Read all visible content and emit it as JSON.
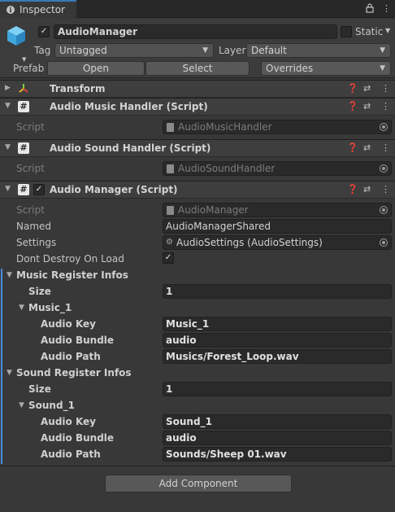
{
  "window": {
    "tab_title": "Inspector"
  },
  "header": {
    "object_name": "AudioManager",
    "active": true,
    "static_label": "Static",
    "tag_label": "Tag",
    "tag_value": "Untagged",
    "layer_label": "Layer",
    "layer_value": "Default",
    "prefab_label": "Prefab",
    "open_label": "Open",
    "select_label": "Select",
    "overrides_label": "Overrides"
  },
  "components": {
    "transform": {
      "title": "Transform"
    },
    "music_handler": {
      "title": "Audio Music Handler (Script)",
      "script_label": "Script",
      "script_value": "AudioMusicHandler"
    },
    "sound_handler": {
      "title": "Audio Sound Handler (Script)",
      "script_label": "Script",
      "script_value": "AudioSoundHandler"
    },
    "audio_manager": {
      "title": "Audio Manager (Script)",
      "enabled": true,
      "script_label": "Script",
      "script_value": "AudioManager",
      "named_label": "Named",
      "named_value": "AudioManagerShared",
      "settings_label": "Settings",
      "settings_value": "AudioSettings (AudioSettings)",
      "dont_destroy_label": "Dont Destroy On Load",
      "dont_destroy_value": true,
      "music": {
        "label": "Music Register Infos",
        "size_label": "Size",
        "size_value": "1",
        "element_label": "Music_1",
        "key_label": "Audio Key",
        "key_value": "Music_1",
        "bundle_label": "Audio Bundle",
        "bundle_value": "audio",
        "path_label": "Audio Path",
        "path_value": "Musics/Forest_Loop.wav"
      },
      "sound": {
        "label": "Sound Register Infos",
        "size_label": "Size",
        "size_value": "1",
        "element_label": "Sound_1",
        "key_label": "Audio Key",
        "key_value": "Sound_1",
        "bundle_label": "Audio Bundle",
        "bundle_value": "audio",
        "path_label": "Audio Path",
        "path_value": "Sounds/Sheep 01.wav"
      }
    }
  },
  "add_component_label": "Add Component",
  "colors": {
    "accent": "#3a79bb",
    "selection_bar": "#4a8de0",
    "panel": "#383838"
  },
  "icons": [
    "info-icon",
    "lock-icon",
    "more-icon",
    "cube-icon",
    "transform-icon",
    "script-icon",
    "help-icon",
    "preset-icon",
    "checkmark-icon",
    "target-icon"
  ]
}
